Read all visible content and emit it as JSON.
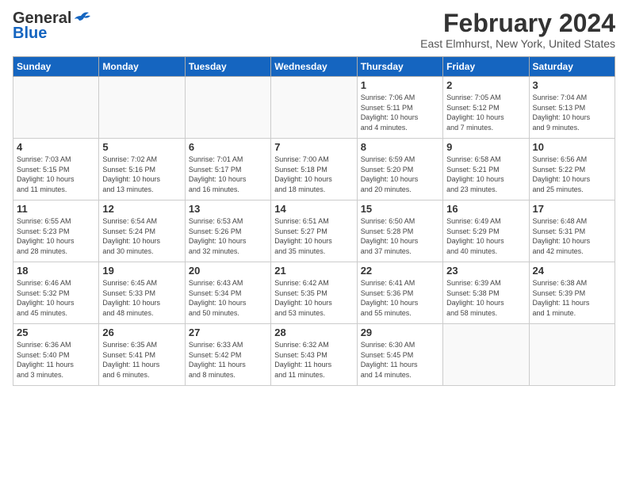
{
  "logo": {
    "line1": "General",
    "line2": "Blue"
  },
  "title": "February 2024",
  "subtitle": "East Elmhurst, New York, United States",
  "days_of_week": [
    "Sunday",
    "Monday",
    "Tuesday",
    "Wednesday",
    "Thursday",
    "Friday",
    "Saturday"
  ],
  "weeks": [
    [
      {
        "day": "",
        "info": ""
      },
      {
        "day": "",
        "info": ""
      },
      {
        "day": "",
        "info": ""
      },
      {
        "day": "",
        "info": ""
      },
      {
        "day": "1",
        "info": "Sunrise: 7:06 AM\nSunset: 5:11 PM\nDaylight: 10 hours\nand 4 minutes."
      },
      {
        "day": "2",
        "info": "Sunrise: 7:05 AM\nSunset: 5:12 PM\nDaylight: 10 hours\nand 7 minutes."
      },
      {
        "day": "3",
        "info": "Sunrise: 7:04 AM\nSunset: 5:13 PM\nDaylight: 10 hours\nand 9 minutes."
      }
    ],
    [
      {
        "day": "4",
        "info": "Sunrise: 7:03 AM\nSunset: 5:15 PM\nDaylight: 10 hours\nand 11 minutes."
      },
      {
        "day": "5",
        "info": "Sunrise: 7:02 AM\nSunset: 5:16 PM\nDaylight: 10 hours\nand 13 minutes."
      },
      {
        "day": "6",
        "info": "Sunrise: 7:01 AM\nSunset: 5:17 PM\nDaylight: 10 hours\nand 16 minutes."
      },
      {
        "day": "7",
        "info": "Sunrise: 7:00 AM\nSunset: 5:18 PM\nDaylight: 10 hours\nand 18 minutes."
      },
      {
        "day": "8",
        "info": "Sunrise: 6:59 AM\nSunset: 5:20 PM\nDaylight: 10 hours\nand 20 minutes."
      },
      {
        "day": "9",
        "info": "Sunrise: 6:58 AM\nSunset: 5:21 PM\nDaylight: 10 hours\nand 23 minutes."
      },
      {
        "day": "10",
        "info": "Sunrise: 6:56 AM\nSunset: 5:22 PM\nDaylight: 10 hours\nand 25 minutes."
      }
    ],
    [
      {
        "day": "11",
        "info": "Sunrise: 6:55 AM\nSunset: 5:23 PM\nDaylight: 10 hours\nand 28 minutes."
      },
      {
        "day": "12",
        "info": "Sunrise: 6:54 AM\nSunset: 5:24 PM\nDaylight: 10 hours\nand 30 minutes."
      },
      {
        "day": "13",
        "info": "Sunrise: 6:53 AM\nSunset: 5:26 PM\nDaylight: 10 hours\nand 32 minutes."
      },
      {
        "day": "14",
        "info": "Sunrise: 6:51 AM\nSunset: 5:27 PM\nDaylight: 10 hours\nand 35 minutes."
      },
      {
        "day": "15",
        "info": "Sunrise: 6:50 AM\nSunset: 5:28 PM\nDaylight: 10 hours\nand 37 minutes."
      },
      {
        "day": "16",
        "info": "Sunrise: 6:49 AM\nSunset: 5:29 PM\nDaylight: 10 hours\nand 40 minutes."
      },
      {
        "day": "17",
        "info": "Sunrise: 6:48 AM\nSunset: 5:31 PM\nDaylight: 10 hours\nand 42 minutes."
      }
    ],
    [
      {
        "day": "18",
        "info": "Sunrise: 6:46 AM\nSunset: 5:32 PM\nDaylight: 10 hours\nand 45 minutes."
      },
      {
        "day": "19",
        "info": "Sunrise: 6:45 AM\nSunset: 5:33 PM\nDaylight: 10 hours\nand 48 minutes."
      },
      {
        "day": "20",
        "info": "Sunrise: 6:43 AM\nSunset: 5:34 PM\nDaylight: 10 hours\nand 50 minutes."
      },
      {
        "day": "21",
        "info": "Sunrise: 6:42 AM\nSunset: 5:35 PM\nDaylight: 10 hours\nand 53 minutes."
      },
      {
        "day": "22",
        "info": "Sunrise: 6:41 AM\nSunset: 5:36 PM\nDaylight: 10 hours\nand 55 minutes."
      },
      {
        "day": "23",
        "info": "Sunrise: 6:39 AM\nSunset: 5:38 PM\nDaylight: 10 hours\nand 58 minutes."
      },
      {
        "day": "24",
        "info": "Sunrise: 6:38 AM\nSunset: 5:39 PM\nDaylight: 11 hours\nand 1 minute."
      }
    ],
    [
      {
        "day": "25",
        "info": "Sunrise: 6:36 AM\nSunset: 5:40 PM\nDaylight: 11 hours\nand 3 minutes."
      },
      {
        "day": "26",
        "info": "Sunrise: 6:35 AM\nSunset: 5:41 PM\nDaylight: 11 hours\nand 6 minutes."
      },
      {
        "day": "27",
        "info": "Sunrise: 6:33 AM\nSunset: 5:42 PM\nDaylight: 11 hours\nand 8 minutes."
      },
      {
        "day": "28",
        "info": "Sunrise: 6:32 AM\nSunset: 5:43 PM\nDaylight: 11 hours\nand 11 minutes."
      },
      {
        "day": "29",
        "info": "Sunrise: 6:30 AM\nSunset: 5:45 PM\nDaylight: 11 hours\nand 14 minutes."
      },
      {
        "day": "",
        "info": ""
      },
      {
        "day": "",
        "info": ""
      }
    ]
  ]
}
